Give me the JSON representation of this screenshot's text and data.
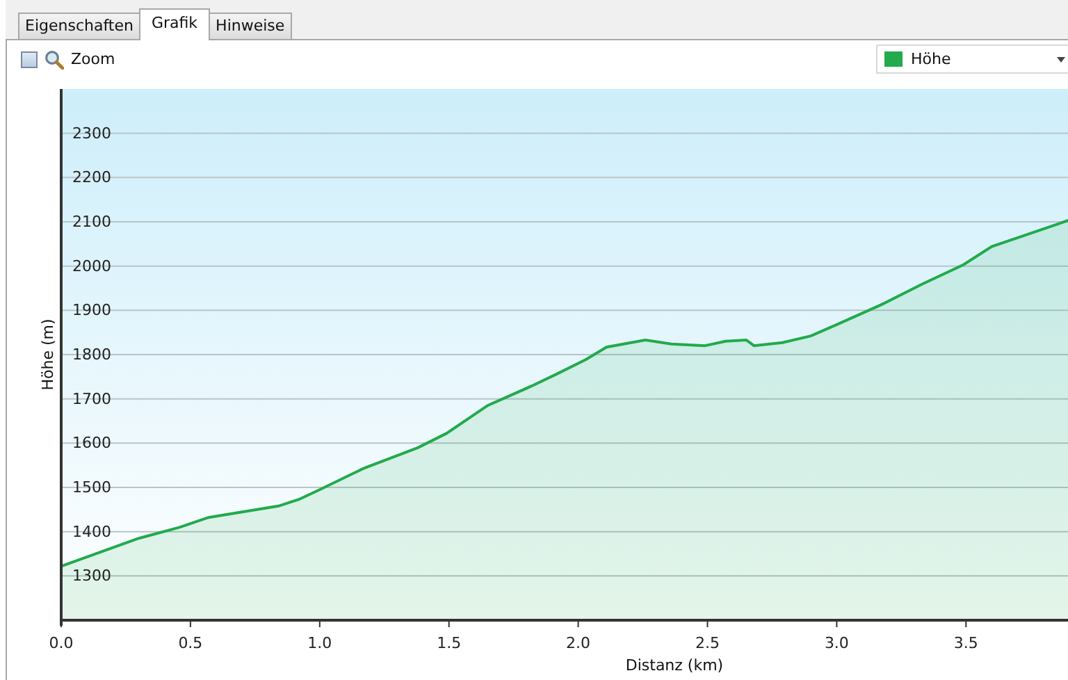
{
  "tabs": [
    {
      "label": "Eigenschaften",
      "selected": false
    },
    {
      "label": "Grafik",
      "selected": true
    },
    {
      "label": "Hinweise",
      "selected": false
    }
  ],
  "toolbar": {
    "zoom_checkbox": {
      "checked": false
    },
    "zoom_label": "Zoom"
  },
  "chart": {
    "chart_data": {
      "type": "area",
      "grid": true,
      "xlabel": "Distanz  (km)",
      "ylabel": "Höhe (m)",
      "x": [
        0,
        0.3,
        0.46,
        0.57,
        0.84,
        0.92,
        1.0,
        1.17,
        1.38,
        1.49,
        1.65,
        1.82,
        1.92,
        2.03,
        2.11,
        2.26,
        2.36,
        2.49,
        2.57,
        2.65,
        2.68,
        2.79,
        2.9,
        3.0,
        3.17,
        3.33,
        3.49,
        3.6,
        3.71,
        3.9
      ],
      "series": [
        {
          "name": "Höhe",
          "color": "#22aa4c",
          "values": [
            1322,
            1385,
            1410,
            1432,
            1458,
            1473,
            1495,
            1543,
            1590,
            1622,
            1685,
            1729,
            1757,
            1789,
            1817,
            1833,
            1824,
            1820,
            1830,
            1833,
            1820,
            1827,
            1842,
            1868,
            1912,
            1959,
            2003,
            2044,
            2066,
            2104
          ]
        }
      ],
      "xlim": [
        0,
        3.9
      ],
      "ylim": [
        1200,
        2400
      ],
      "xticks": [
        {
          "value": 0,
          "label": "0.0"
        },
        {
          "value": 0.5,
          "label": "0.5"
        },
        {
          "value": 1,
          "label": "1.0"
        },
        {
          "value": 1.5,
          "label": "1.5"
        },
        {
          "value": 2,
          "label": "2.0"
        },
        {
          "value": 2.5,
          "label": "2.5"
        },
        {
          "value": 3,
          "label": "3.0"
        },
        {
          "value": 3.5,
          "label": "3.5"
        }
      ],
      "yticks": [
        1300,
        1400,
        1500,
        1600,
        1700,
        1800,
        1900,
        2000,
        2100,
        2200,
        2300
      ]
    }
  }
}
